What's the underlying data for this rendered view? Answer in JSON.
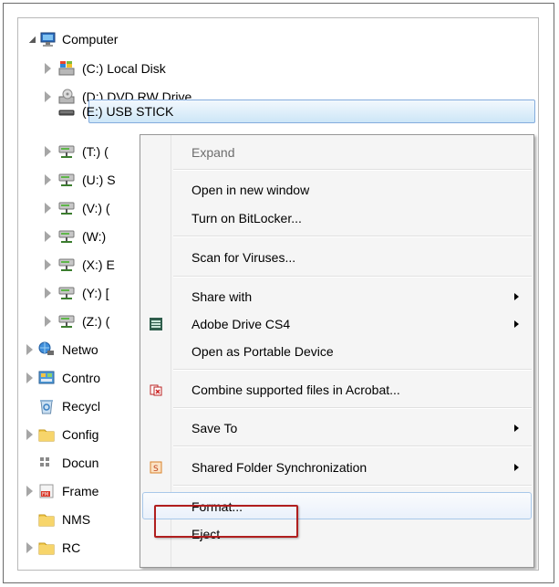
{
  "tree": {
    "computer": "Computer",
    "items": [
      {
        "label": "(C:) Local Disk"
      },
      {
        "label": "(D:) DVD RW Drive"
      },
      {
        "label": "(E:) USB STICK"
      },
      {
        "label": "(T:) ("
      },
      {
        "label": "(U:) S"
      },
      {
        "label": "(V:) ("
      },
      {
        "label": "(W:)"
      },
      {
        "label": "(X:) E"
      },
      {
        "label": "(Y:) ["
      },
      {
        "label": "(Z:) ("
      }
    ],
    "roots": [
      {
        "label": "Netwo"
      },
      {
        "label": "Contro"
      },
      {
        "label": "Recycl"
      },
      {
        "label": "Config"
      },
      {
        "label": "Docun"
      },
      {
        "label": "Frame"
      },
      {
        "label": "NMS"
      },
      {
        "label": "RC"
      }
    ]
  },
  "context_menu": {
    "items": [
      {
        "label": "Expand",
        "disabled": true
      },
      {
        "label": "Open in new window"
      },
      {
        "label": "Turn on BitLocker..."
      },
      {
        "label": "Scan for Viruses..."
      },
      {
        "label": "Share with",
        "submenu": true
      },
      {
        "label": "Adobe Drive CS4",
        "submenu": true
      },
      {
        "label": "Open as Portable Device"
      },
      {
        "label": "Combine supported files in Acrobat..."
      },
      {
        "label": "Save To",
        "submenu": true
      },
      {
        "label": "Shared Folder Synchronization",
        "submenu": true
      },
      {
        "label": "Format..."
      },
      {
        "label": "Eject"
      }
    ]
  },
  "colors": {
    "selection": "#cde6f7",
    "highlight_border": "#b01e1e"
  }
}
